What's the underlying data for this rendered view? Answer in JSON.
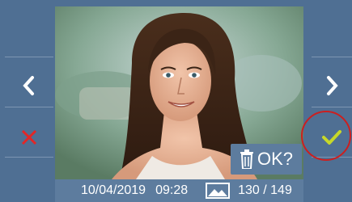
{
  "bottom_bar": {
    "date": "10/04/2019",
    "time": "09:28",
    "counter": "130 / 149"
  },
  "ok_prompt": "OK?",
  "colors": {
    "panel": "#4f6f93",
    "bar": "#5d7c9e",
    "accept": "#c7d829",
    "delete": "#e32626",
    "highlight_ring": "#cc1f1f"
  },
  "icons": {
    "prev": "chevron-left-icon",
    "next": "chevron-right-icon",
    "delete": "close-icon",
    "accept": "check-icon",
    "trash": "trash-icon",
    "gallery": "image-icon"
  }
}
